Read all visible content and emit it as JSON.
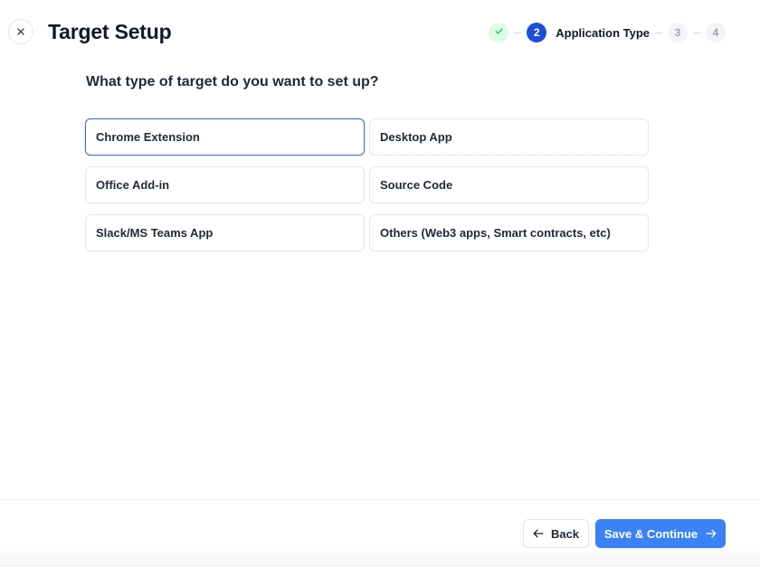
{
  "header": {
    "title": "Target Setup",
    "close_icon": "close-icon"
  },
  "stepper": {
    "steps": [
      {
        "number": "",
        "state": "completed",
        "icon": "check-icon"
      },
      {
        "number": "2",
        "state": "active",
        "label": "Application Type"
      },
      {
        "number": "3",
        "state": "pending"
      },
      {
        "number": "4",
        "state": "pending"
      }
    ]
  },
  "main": {
    "question": "What type of target do you want to set up?",
    "options": [
      {
        "label": "Chrome Extension",
        "selected": true
      },
      {
        "label": "Desktop App",
        "selected": false
      },
      {
        "label": "Office Add-in",
        "selected": false
      },
      {
        "label": "Source Code",
        "selected": false
      },
      {
        "label": "Slack/MS Teams App",
        "selected": false
      },
      {
        "label": "Others (Web3 apps, Smart contracts, etc)",
        "selected": false
      }
    ]
  },
  "footer": {
    "back_label": "Back",
    "save_label": "Save & Continue",
    "back_icon": "arrow-left-icon",
    "save_icon": "arrow-right-icon"
  },
  "colors": {
    "accent": "#3b82f6",
    "active_step": "#1d4ed8",
    "completed_step_bg": "#dcfce7",
    "completed_check": "#22c55e",
    "selected_border": "#3b6fd8"
  }
}
